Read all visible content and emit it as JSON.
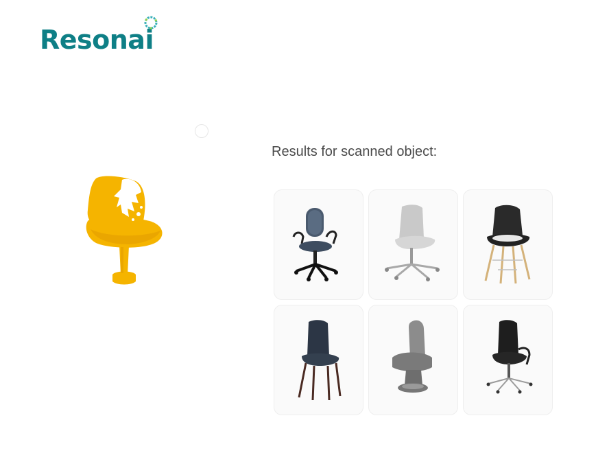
{
  "brand": {
    "name": "Resonai",
    "color": "#0e7f86",
    "accent": "#3ab0b8"
  },
  "results": {
    "title": "Results for scanned object:",
    "items": [
      {
        "name": "blue office chair with armrests"
      },
      {
        "name": "grey shell chair on swivel base"
      },
      {
        "name": "black eames-style chair with wooden legs"
      },
      {
        "name": "dark fabric dining chair"
      },
      {
        "name": "grey car-seat style chair"
      },
      {
        "name": "black high-back office chair"
      }
    ]
  },
  "scan": {
    "name": "scanned yellow tulip chair",
    "color": "#f5b400"
  }
}
